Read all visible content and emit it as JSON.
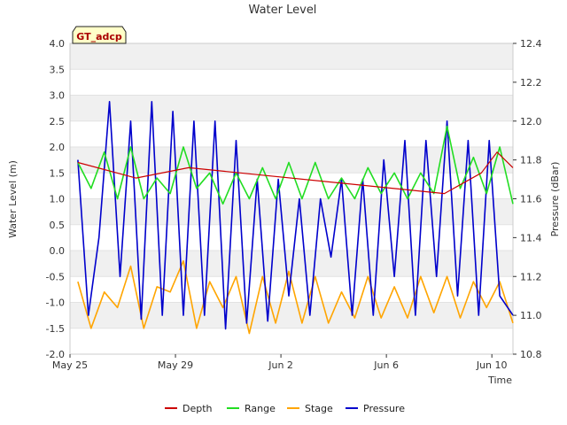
{
  "chart_data": {
    "type": "line",
    "title": "Water Level",
    "badge": "GT_adcp",
    "xlabel": "Time",
    "ylabel": "Water Level (m)",
    "ylabel_right": "Pressure (dBar)",
    "x_ticks": [
      "May 25",
      "May 29",
      "Jun 2",
      "Jun 6",
      "Jun 10"
    ],
    "x_range_days": [
      0,
      16.8
    ],
    "x_tick_days": [
      0,
      4,
      8,
      12,
      16
    ],
    "y_ticks": [
      "-2.0",
      "-1.5",
      "-1.0",
      "-0.5",
      "0.0",
      "0.5",
      "1.0",
      "1.5",
      "2.0",
      "2.5",
      "3.0",
      "3.5",
      "4.0"
    ],
    "ylim": [
      -2.0,
      4.0
    ],
    "y_right_ticks": [
      "10.8",
      "11.0",
      "11.2",
      "11.4",
      "11.6",
      "11.8",
      "12.0",
      "12.2",
      "12.4"
    ],
    "ylim_right": [
      10.8,
      12.4
    ],
    "grid": "horizontal bands",
    "legend_position": "bottom",
    "colors": {
      "Depth": "#cc0000",
      "Range": "#22dd22",
      "Stage": "#ffa500",
      "Pressure": "#0000cc"
    },
    "series": [
      {
        "name": "Depth",
        "x": [
          0.3,
          2.5,
          4.5,
          14.2,
          15.6,
          16.2,
          16.8
        ],
        "y": [
          1.7,
          1.4,
          1.6,
          1.1,
          1.5,
          1.9,
          1.6
        ]
      },
      {
        "name": "Range",
        "x": [
          0.3,
          0.8,
          1.3,
          1.8,
          2.3,
          2.8,
          3.3,
          3.8,
          4.3,
          4.8,
          5.3,
          5.8,
          6.3,
          6.8,
          7.3,
          7.8,
          8.3,
          8.8,
          9.3,
          9.8,
          10.3,
          10.8,
          11.3,
          11.8,
          12.3,
          12.8,
          13.3,
          13.8,
          14.3,
          14.8,
          15.3,
          15.8,
          16.3,
          16.8
        ],
        "y": [
          1.7,
          1.2,
          1.9,
          1.0,
          2.0,
          1.0,
          1.4,
          1.1,
          2.0,
          1.2,
          1.5,
          0.9,
          1.5,
          1.0,
          1.6,
          1.0,
          1.7,
          1.0,
          1.7,
          1.0,
          1.4,
          1.0,
          1.6,
          1.1,
          1.5,
          1.0,
          1.5,
          1.1,
          2.4,
          1.2,
          1.8,
          1.1,
          2.0,
          0.9
        ]
      },
      {
        "name": "Stage",
        "x": [
          0.3,
          0.8,
          1.3,
          1.8,
          2.3,
          2.8,
          3.3,
          3.8,
          4.3,
          4.8,
          5.3,
          5.8,
          6.3,
          6.8,
          7.3,
          7.8,
          8.3,
          8.8,
          9.3,
          9.8,
          10.3,
          10.8,
          11.3,
          11.8,
          12.3,
          12.8,
          13.3,
          13.8,
          14.3,
          14.8,
          15.3,
          15.8,
          16.3,
          16.8
        ],
        "y": [
          -0.6,
          -1.5,
          -0.8,
          -1.1,
          -0.3,
          -1.5,
          -0.7,
          -0.8,
          -0.2,
          -1.5,
          -0.6,
          -1.1,
          -0.5,
          -1.6,
          -0.5,
          -1.4,
          -0.4,
          -1.4,
          -0.5,
          -1.4,
          -0.8,
          -1.3,
          -0.5,
          -1.3,
          -0.7,
          -1.3,
          -0.5,
          -1.2,
          -0.5,
          -1.3,
          -0.6,
          -1.1,
          -0.6,
          -1.4
        ]
      },
      {
        "name": "Pressure",
        "x": [
          0.3,
          0.7,
          1.1,
          1.5,
          1.9,
          2.3,
          2.7,
          3.1,
          3.5,
          3.9,
          4.3,
          4.7,
          5.1,
          5.5,
          5.9,
          6.3,
          6.7,
          7.1,
          7.5,
          7.9,
          8.3,
          8.7,
          9.1,
          9.5,
          9.9,
          10.3,
          10.7,
          11.1,
          11.5,
          11.9,
          12.3,
          12.7,
          13.1,
          13.5,
          13.9,
          14.3,
          14.7,
          15.1,
          15.5,
          15.9,
          16.3,
          16.8
        ],
        "y": [
          11.8,
          11.0,
          11.4,
          12.1,
          11.2,
          12.0,
          10.98,
          12.1,
          11.0,
          12.05,
          11.0,
          12.0,
          11.0,
          12.0,
          10.93,
          11.9,
          10.96,
          11.7,
          10.97,
          11.7,
          11.1,
          11.6,
          11.0,
          11.6,
          11.3,
          11.7,
          11.0,
          11.7,
          11.0,
          11.8,
          11.2,
          11.9,
          11.0,
          11.9,
          11.2,
          12.0,
          11.1,
          11.9,
          11.0,
          11.9,
          11.1,
          11.0
        ]
      }
    ]
  }
}
